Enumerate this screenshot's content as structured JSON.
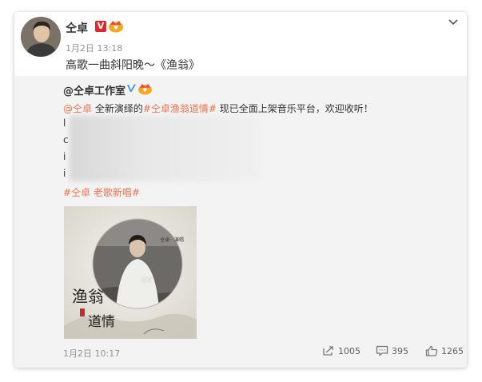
{
  "post": {
    "author": "仝卓",
    "verified_label": "V",
    "time": "1月2日 13:18",
    "text": "高歌一曲斜阳晚～《渔翁》"
  },
  "repost": {
    "author": "@仝卓工作室",
    "mention": "@仝卓",
    "text_a": " 全新演绎的",
    "topic": "#仝卓渔翁道情#",
    "text_b": " 现已全面上架音乐平台，欢迎收听！",
    "blurred_rows": [
      "l",
      "c",
      "i",
      "i"
    ],
    "tag_1": "#仝卓 老歌新唱#",
    "album_title_a": "渔翁",
    "album_title_b": "道情",
    "album_caption": "仝卓 · 演唱",
    "time": "1月2日 10:17",
    "actions": {
      "reposts": "1005",
      "comments": "395",
      "likes": "1265"
    }
  },
  "colors": {
    "link": "#eb7350",
    "verified_red": "#e0262e",
    "verified_blue": "#3a8ee6",
    "repost_bg": "#f3f3f3"
  },
  "icons": {
    "chevron": "chevron-down-icon",
    "repost": "repost-icon",
    "comment": "comment-icon",
    "like": "thumbs-up-icon"
  }
}
